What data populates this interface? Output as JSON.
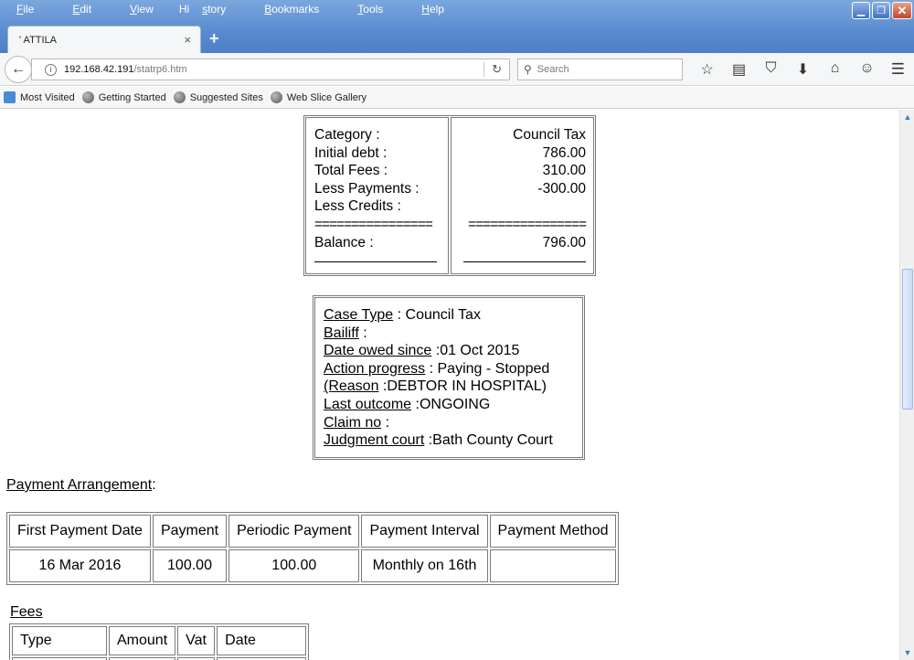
{
  "menu": [
    {
      "pre": "",
      "u": "F",
      "post": "ile"
    },
    {
      "pre": "",
      "u": "E",
      "post": "dit"
    },
    {
      "pre": "",
      "u": "V",
      "post": "iew"
    },
    {
      "pre": "Hi",
      "u": "s",
      "post": "tory"
    },
    {
      "pre": "",
      "u": "B",
      "post": "ookmarks"
    },
    {
      "pre": "",
      "u": "T",
      "post": "ools"
    },
    {
      "pre": "",
      "u": "H",
      "post": "elp"
    }
  ],
  "tab": {
    "title": "' ATTILA",
    "close": "×"
  },
  "new_tab": "+",
  "url": {
    "host": "192.168.42.191",
    "path": "/statrp6.htm"
  },
  "search": {
    "placeholder": "Search"
  },
  "bookmarks": [
    "Most Visited",
    "Getting Started",
    "Suggested Sites",
    "Web Slice Gallery"
  ],
  "balance": {
    "labels": [
      "Category :",
      "Initial debt :",
      "Total Fees :",
      "Less Payments :",
      "Less Credits :",
      "================",
      "Balance :"
    ],
    "values": [
      "Council Tax",
      "786.00",
      "310.00",
      "-300.00",
      "",
      "================",
      "796.00"
    ]
  },
  "case": {
    "case_type_key": "Case Type",
    "case_type_val": " : Council Tax",
    "bailiff_key": "Bailiff",
    "bailiff_val": " :",
    "owed_key": "Date owed since",
    "owed_val": " :01 Oct 2015",
    "action_key": "Action progress",
    "action_val": " : Paying - Stopped",
    "reason_key": "(Reason",
    "reason_val": " :DEBTOR IN HOSPITAL)",
    "outcome_key": "Last outcome",
    "outcome_val": " :ONGOING",
    "claim_key": "Claim no",
    "claim_val": " :",
    "court_key": "Judgment court",
    "court_val": " :Bath County Court"
  },
  "payment_arrangement": {
    "title": "Payment Arrangement",
    "suffix": " :",
    "headers": [
      "First Payment Date",
      "Payment",
      "Periodic Payment",
      "Payment Interval",
      "Payment Method"
    ],
    "row": [
      "16 Mar 2016",
      "100.00",
      "100.00",
      "Monthly on 16th",
      ""
    ]
  },
  "fees": {
    "title": "Fees",
    "headers": [
      "Type",
      "Amount",
      "Vat",
      "Date"
    ]
  }
}
